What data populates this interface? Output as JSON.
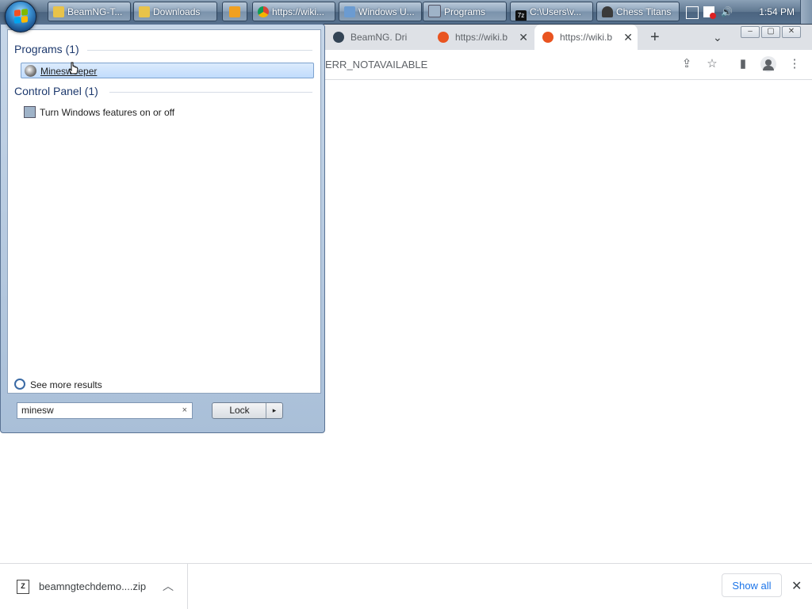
{
  "taskbar": {
    "buttons": [
      {
        "label": "BeamNG-T...",
        "icon": "folder-icon"
      },
      {
        "label": "Downloads",
        "icon": "folder-icon"
      },
      {
        "label": "",
        "icon": "media-player-icon"
      },
      {
        "label": "https://wiki...",
        "icon": "chrome-icon"
      },
      {
        "label": "Windows U...",
        "icon": "windows-update-icon"
      },
      {
        "label": "Programs",
        "icon": "control-panel-icon"
      },
      {
        "label": "C:\\Users\\v...",
        "icon": "7zip-icon"
      },
      {
        "label": "Chess Titans",
        "icon": "chess-icon"
      }
    ],
    "clock": "1:54 PM"
  },
  "browser": {
    "tabs": [
      {
        "label": "BeamNG. Dri",
        "icon": "beamng-icon"
      },
      {
        "label": "https://wiki.b",
        "icon": "ubuntu-icon"
      },
      {
        "label": "https://wiki.b",
        "icon": "ubuntu-icon"
      }
    ],
    "new_tab": "+",
    "tab_menu": "⌄",
    "url_fragment": "ERR_NOTAVAILABLE"
  },
  "start_menu": {
    "programs_header": "Programs (1)",
    "programs": [
      {
        "label": "Minesweeper",
        "icon": "minesweeper-icon"
      }
    ],
    "control_panel_header": "Control Panel (1)",
    "control_panel": [
      {
        "label": "Turn Windows features on or off",
        "icon": "windows-features-icon"
      }
    ],
    "see_more": "See more results",
    "search_value": "minesw",
    "search_clear": "×",
    "lock_label": "Lock",
    "lock_arrow": "▸"
  },
  "downloads": {
    "file_name": "beamngtechdemo....zip",
    "show_all": "Show all",
    "close": "✕"
  },
  "colors": {
    "taskbar": "#5f7790",
    "start_menu_frame": "#a9bfd8",
    "selection": "#c1dcfc",
    "header_text": "#1e3a6e",
    "link_blue": "#1a73e8"
  }
}
